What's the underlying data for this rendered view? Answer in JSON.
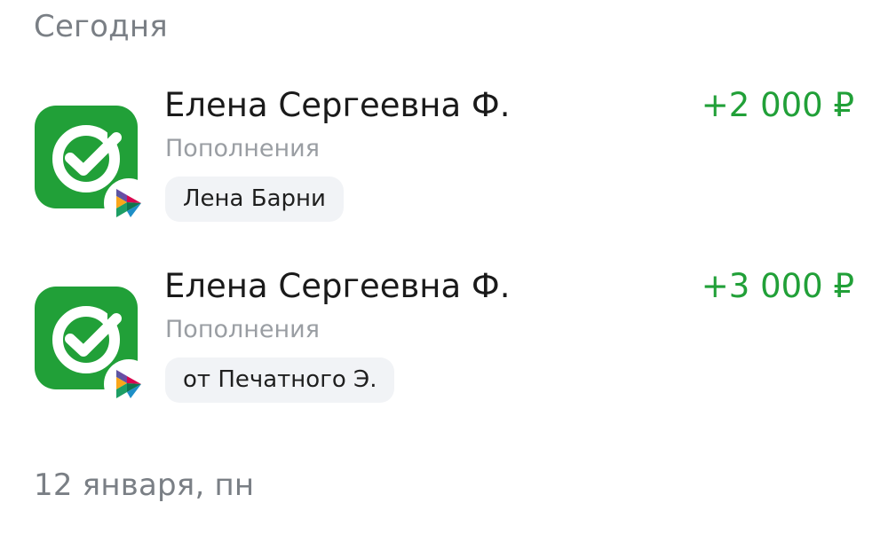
{
  "groups": [
    {
      "date_label": "Сегодня",
      "transactions": [
        {
          "counterparty": "Елена Сергеевна Ф.",
          "category": "Пополнения",
          "message": "Лена Барни",
          "amount": "+2 000 ₽",
          "icon": "sberbank-logo-icon",
          "badge_icon": "sbp-transfer-icon"
        },
        {
          "counterparty": "Елена Сергеевна Ф.",
          "category": "Пополнения",
          "message": "от Печатного Э.",
          "amount": "+3 000 ₽",
          "icon": "sberbank-logo-icon",
          "badge_icon": "sbp-transfer-icon"
        }
      ]
    },
    {
      "date_label": "12 января, пн",
      "transactions": []
    }
  ],
  "colors": {
    "income_amount": "#21a038",
    "brand_green": "#21a038",
    "group_header": "#7a7f85",
    "secondary_text": "#9a9ea3",
    "chip_background": "#f1f3f6"
  }
}
